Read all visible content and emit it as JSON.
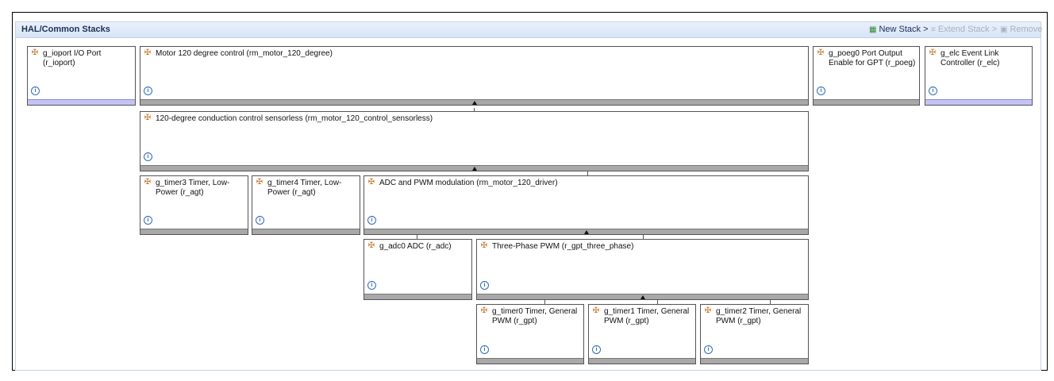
{
  "panel": {
    "title": "HAL/Common Stacks",
    "buttons": {
      "new_stack": "New Stack >",
      "extend_stack": "Extend Stack >",
      "remove": "Remove"
    }
  },
  "modules": {
    "ioport": "g_ioport I/O Port (r_ioport)",
    "motor_120": "Motor 120 degree control (rm_motor_120_degree)",
    "poeg0": "g_poeg0 Port Output Enable for GPT (r_poeg)",
    "elc": "g_elc Event Link Controller (r_elc)",
    "sensorless": "120-degree conduction control sensorless (rm_motor_120_control_sensorless)",
    "timer3": "g_timer3 Timer, Low-Power (r_agt)",
    "timer4": "g_timer4 Timer, Low-Power (r_agt)",
    "driver": "ADC and PWM modulation  (rm_motor_120_driver)",
    "adc0": "g_adc0 ADC (r_adc)",
    "three_phase": "Three-Phase PWM (r_gpt_three_phase)",
    "timer0": "g_timer0 Timer, General PWM (r_gpt)",
    "timer1": "g_timer1 Timer, General PWM (r_gpt)",
    "timer2": "g_timer2 Timer, General PWM (r_gpt)"
  },
  "icons": {
    "module": "module-icon",
    "info": "info-icon",
    "new_stack": "new-stack-icon",
    "extend_stack": "extend-stack-icon",
    "remove": "remove-icon"
  },
  "colors": {
    "header_bg": "#d7e4f7",
    "module_bar": "#a8a8a8",
    "common_bar": "#c4c4f4",
    "module_icon": "#c27a2a",
    "info_icon": "#2b6cc4"
  }
}
